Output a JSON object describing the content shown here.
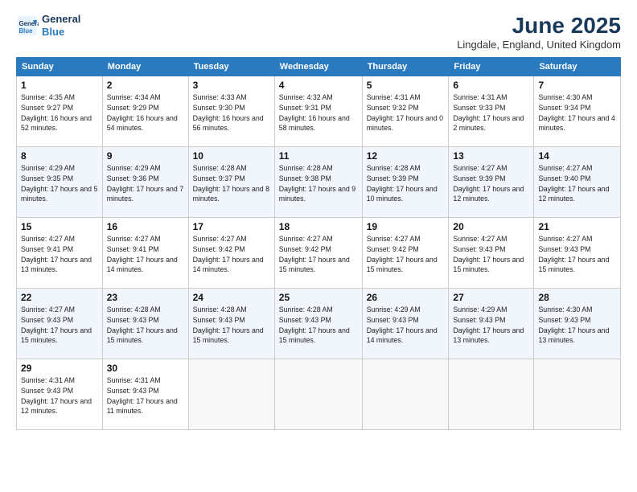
{
  "logo": {
    "line1": "General",
    "line2": "Blue"
  },
  "title": "June 2025",
  "location": "Lingdale, England, United Kingdom",
  "days_of_week": [
    "Sunday",
    "Monday",
    "Tuesday",
    "Wednesday",
    "Thursday",
    "Friday",
    "Saturday"
  ],
  "weeks": [
    [
      {
        "day": "1",
        "sunrise": "4:35 AM",
        "sunset": "9:27 PM",
        "daylight": "16 hours and 52 minutes."
      },
      {
        "day": "2",
        "sunrise": "4:34 AM",
        "sunset": "9:29 PM",
        "daylight": "16 hours and 54 minutes."
      },
      {
        "day": "3",
        "sunrise": "4:33 AM",
        "sunset": "9:30 PM",
        "daylight": "16 hours and 56 minutes."
      },
      {
        "day": "4",
        "sunrise": "4:32 AM",
        "sunset": "9:31 PM",
        "daylight": "16 hours and 58 minutes."
      },
      {
        "day": "5",
        "sunrise": "4:31 AM",
        "sunset": "9:32 PM",
        "daylight": "17 hours and 0 minutes."
      },
      {
        "day": "6",
        "sunrise": "4:31 AM",
        "sunset": "9:33 PM",
        "daylight": "17 hours and 2 minutes."
      },
      {
        "day": "7",
        "sunrise": "4:30 AM",
        "sunset": "9:34 PM",
        "daylight": "17 hours and 4 minutes."
      }
    ],
    [
      {
        "day": "8",
        "sunrise": "4:29 AM",
        "sunset": "9:35 PM",
        "daylight": "17 hours and 5 minutes."
      },
      {
        "day": "9",
        "sunrise": "4:29 AM",
        "sunset": "9:36 PM",
        "daylight": "17 hours and 7 minutes."
      },
      {
        "day": "10",
        "sunrise": "4:28 AM",
        "sunset": "9:37 PM",
        "daylight": "17 hours and 8 minutes."
      },
      {
        "day": "11",
        "sunrise": "4:28 AM",
        "sunset": "9:38 PM",
        "daylight": "17 hours and 9 minutes."
      },
      {
        "day": "12",
        "sunrise": "4:28 AM",
        "sunset": "9:39 PM",
        "daylight": "17 hours and 10 minutes."
      },
      {
        "day": "13",
        "sunrise": "4:27 AM",
        "sunset": "9:39 PM",
        "daylight": "17 hours and 12 minutes."
      },
      {
        "day": "14",
        "sunrise": "4:27 AM",
        "sunset": "9:40 PM",
        "daylight": "17 hours and 12 minutes."
      }
    ],
    [
      {
        "day": "15",
        "sunrise": "4:27 AM",
        "sunset": "9:41 PM",
        "daylight": "17 hours and 13 minutes."
      },
      {
        "day": "16",
        "sunrise": "4:27 AM",
        "sunset": "9:41 PM",
        "daylight": "17 hours and 14 minutes."
      },
      {
        "day": "17",
        "sunrise": "4:27 AM",
        "sunset": "9:42 PM",
        "daylight": "17 hours and 14 minutes."
      },
      {
        "day": "18",
        "sunrise": "4:27 AM",
        "sunset": "9:42 PM",
        "daylight": "17 hours and 15 minutes."
      },
      {
        "day": "19",
        "sunrise": "4:27 AM",
        "sunset": "9:42 PM",
        "daylight": "17 hours and 15 minutes."
      },
      {
        "day": "20",
        "sunrise": "4:27 AM",
        "sunset": "9:43 PM",
        "daylight": "17 hours and 15 minutes."
      },
      {
        "day": "21",
        "sunrise": "4:27 AM",
        "sunset": "9:43 PM",
        "daylight": "17 hours and 15 minutes."
      }
    ],
    [
      {
        "day": "22",
        "sunrise": "4:27 AM",
        "sunset": "9:43 PM",
        "daylight": "17 hours and 15 minutes."
      },
      {
        "day": "23",
        "sunrise": "4:28 AM",
        "sunset": "9:43 PM",
        "daylight": "17 hours and 15 minutes."
      },
      {
        "day": "24",
        "sunrise": "4:28 AM",
        "sunset": "9:43 PM",
        "daylight": "17 hours and 15 minutes."
      },
      {
        "day": "25",
        "sunrise": "4:28 AM",
        "sunset": "9:43 PM",
        "daylight": "17 hours and 15 minutes."
      },
      {
        "day": "26",
        "sunrise": "4:29 AM",
        "sunset": "9:43 PM",
        "daylight": "17 hours and 14 minutes."
      },
      {
        "day": "27",
        "sunrise": "4:29 AM",
        "sunset": "9:43 PM",
        "daylight": "17 hours and 13 minutes."
      },
      {
        "day": "28",
        "sunrise": "4:30 AM",
        "sunset": "9:43 PM",
        "daylight": "17 hours and 13 minutes."
      }
    ],
    [
      {
        "day": "29",
        "sunrise": "4:31 AM",
        "sunset": "9:43 PM",
        "daylight": "17 hours and 12 minutes."
      },
      {
        "day": "30",
        "sunrise": "4:31 AM",
        "sunset": "9:43 PM",
        "daylight": "17 hours and 11 minutes."
      },
      null,
      null,
      null,
      null,
      null
    ]
  ]
}
